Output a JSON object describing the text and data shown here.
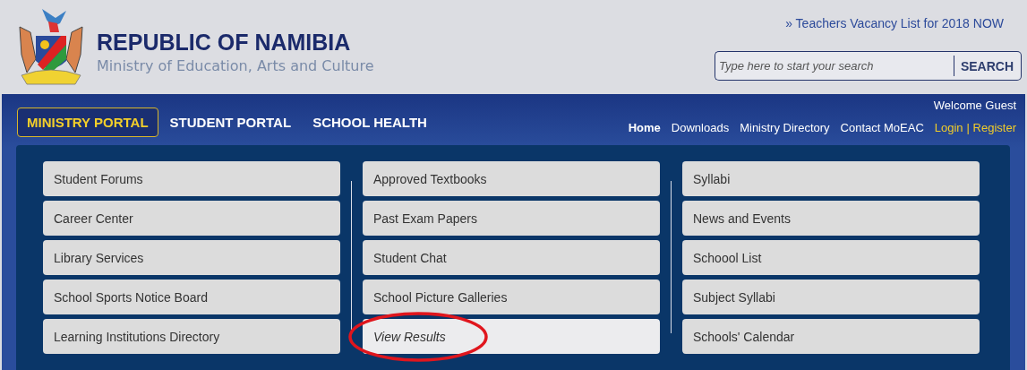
{
  "header": {
    "title": "REPUBLIC OF NAMIBIA",
    "subtitle": "Ministry of Education, Arts and Culture",
    "announcement": "» Teachers Vacancy List for 2018 NOW",
    "search": {
      "placeholder": "Type here to start your search",
      "button": "SEARCH"
    }
  },
  "portal_tabs": [
    {
      "label": "MINISTRY PORTAL",
      "selected": true
    },
    {
      "label": "STUDENT PORTAL",
      "selected": false
    },
    {
      "label": "SCHOOL HEALTH",
      "selected": false
    }
  ],
  "welcome": "Welcome Guest",
  "top_links": [
    {
      "label": "Home",
      "kind": "current"
    },
    {
      "label": "Downloads",
      "kind": "link"
    },
    {
      "label": "Ministry Directory",
      "kind": "link"
    },
    {
      "label": "Contact MoEAC",
      "kind": "link"
    },
    {
      "label": "Login",
      "kind": "account"
    },
    {
      "label": "| Register",
      "kind": "account"
    }
  ],
  "menu_columns": [
    [
      {
        "label": "Student Forums",
        "selected": false
      },
      {
        "label": "Career Center",
        "selected": false
      },
      {
        "label": "Library Services",
        "selected": false
      },
      {
        "label": "School Sports Notice Board",
        "selected": false
      },
      {
        "label": "Learning Institutions Directory",
        "selected": false
      }
    ],
    [
      {
        "label": "Approved Textbooks",
        "selected": false
      },
      {
        "label": "Past Exam Papers",
        "selected": false
      },
      {
        "label": "Student Chat",
        "selected": false
      },
      {
        "label": "School Picture Galleries",
        "selected": false
      },
      {
        "label": "View Results",
        "selected": true,
        "circled": true
      }
    ],
    [
      {
        "label": "Syllabi",
        "selected": false
      },
      {
        "label": "News and Events",
        "selected": false
      },
      {
        "label": "Schoool List",
        "selected": false
      },
      {
        "label": "Subject Syllabi",
        "selected": false
      },
      {
        "label": "Schools' Calendar",
        "selected": false
      }
    ]
  ]
}
